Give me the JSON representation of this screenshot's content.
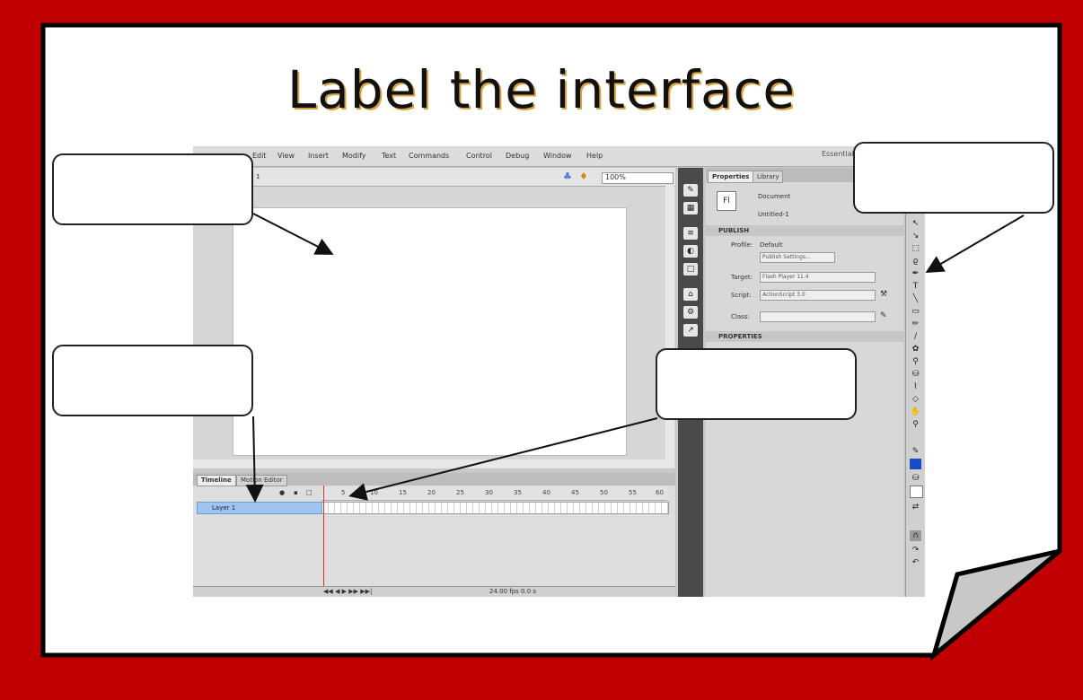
{
  "title": "Label the interface",
  "flash": {
    "menu": [
      "Edit",
      "View",
      "Insert",
      "Modify",
      "Text",
      "Commands",
      "Control",
      "Debug",
      "Window",
      "Help"
    ],
    "workspace_label": "Essentials ▾",
    "search_placeholder": "ρ",
    "scene_label": "1",
    "zoom": "100%",
    "timeline": {
      "tab_timeline": "Timeline",
      "tab_motion_editor": "Motion Editor",
      "ruler": [
        "5",
        "10",
        "15",
        "20",
        "25",
        "30",
        "35",
        "40",
        "45",
        "50",
        "55",
        "60"
      ],
      "layer_name": "Layer 1",
      "footer": "24.00 fps  0.0 s"
    },
    "properties": {
      "tab_properties": "Properties",
      "tab_library": "Library",
      "doc_icon": "Fl",
      "doc_type": "Document",
      "doc_name": "Untitled-1",
      "publish_header": "PUBLISH",
      "profile_label": "Profile:",
      "profile_value": "Default",
      "publish_settings_button": "Publish Settings...",
      "target_label": "Target:",
      "target_value": "Flash Player 11.4",
      "script_label": "Script:",
      "script_value": "ActionScript 3.0",
      "class_label": "Class:",
      "properties_header": "PROPERTIES"
    }
  },
  "label_boxes": [
    "",
    "",
    "",
    ""
  ],
  "colors": {
    "frame_red": "#c00000",
    "accent_title_shadow": "#d9a23f"
  }
}
